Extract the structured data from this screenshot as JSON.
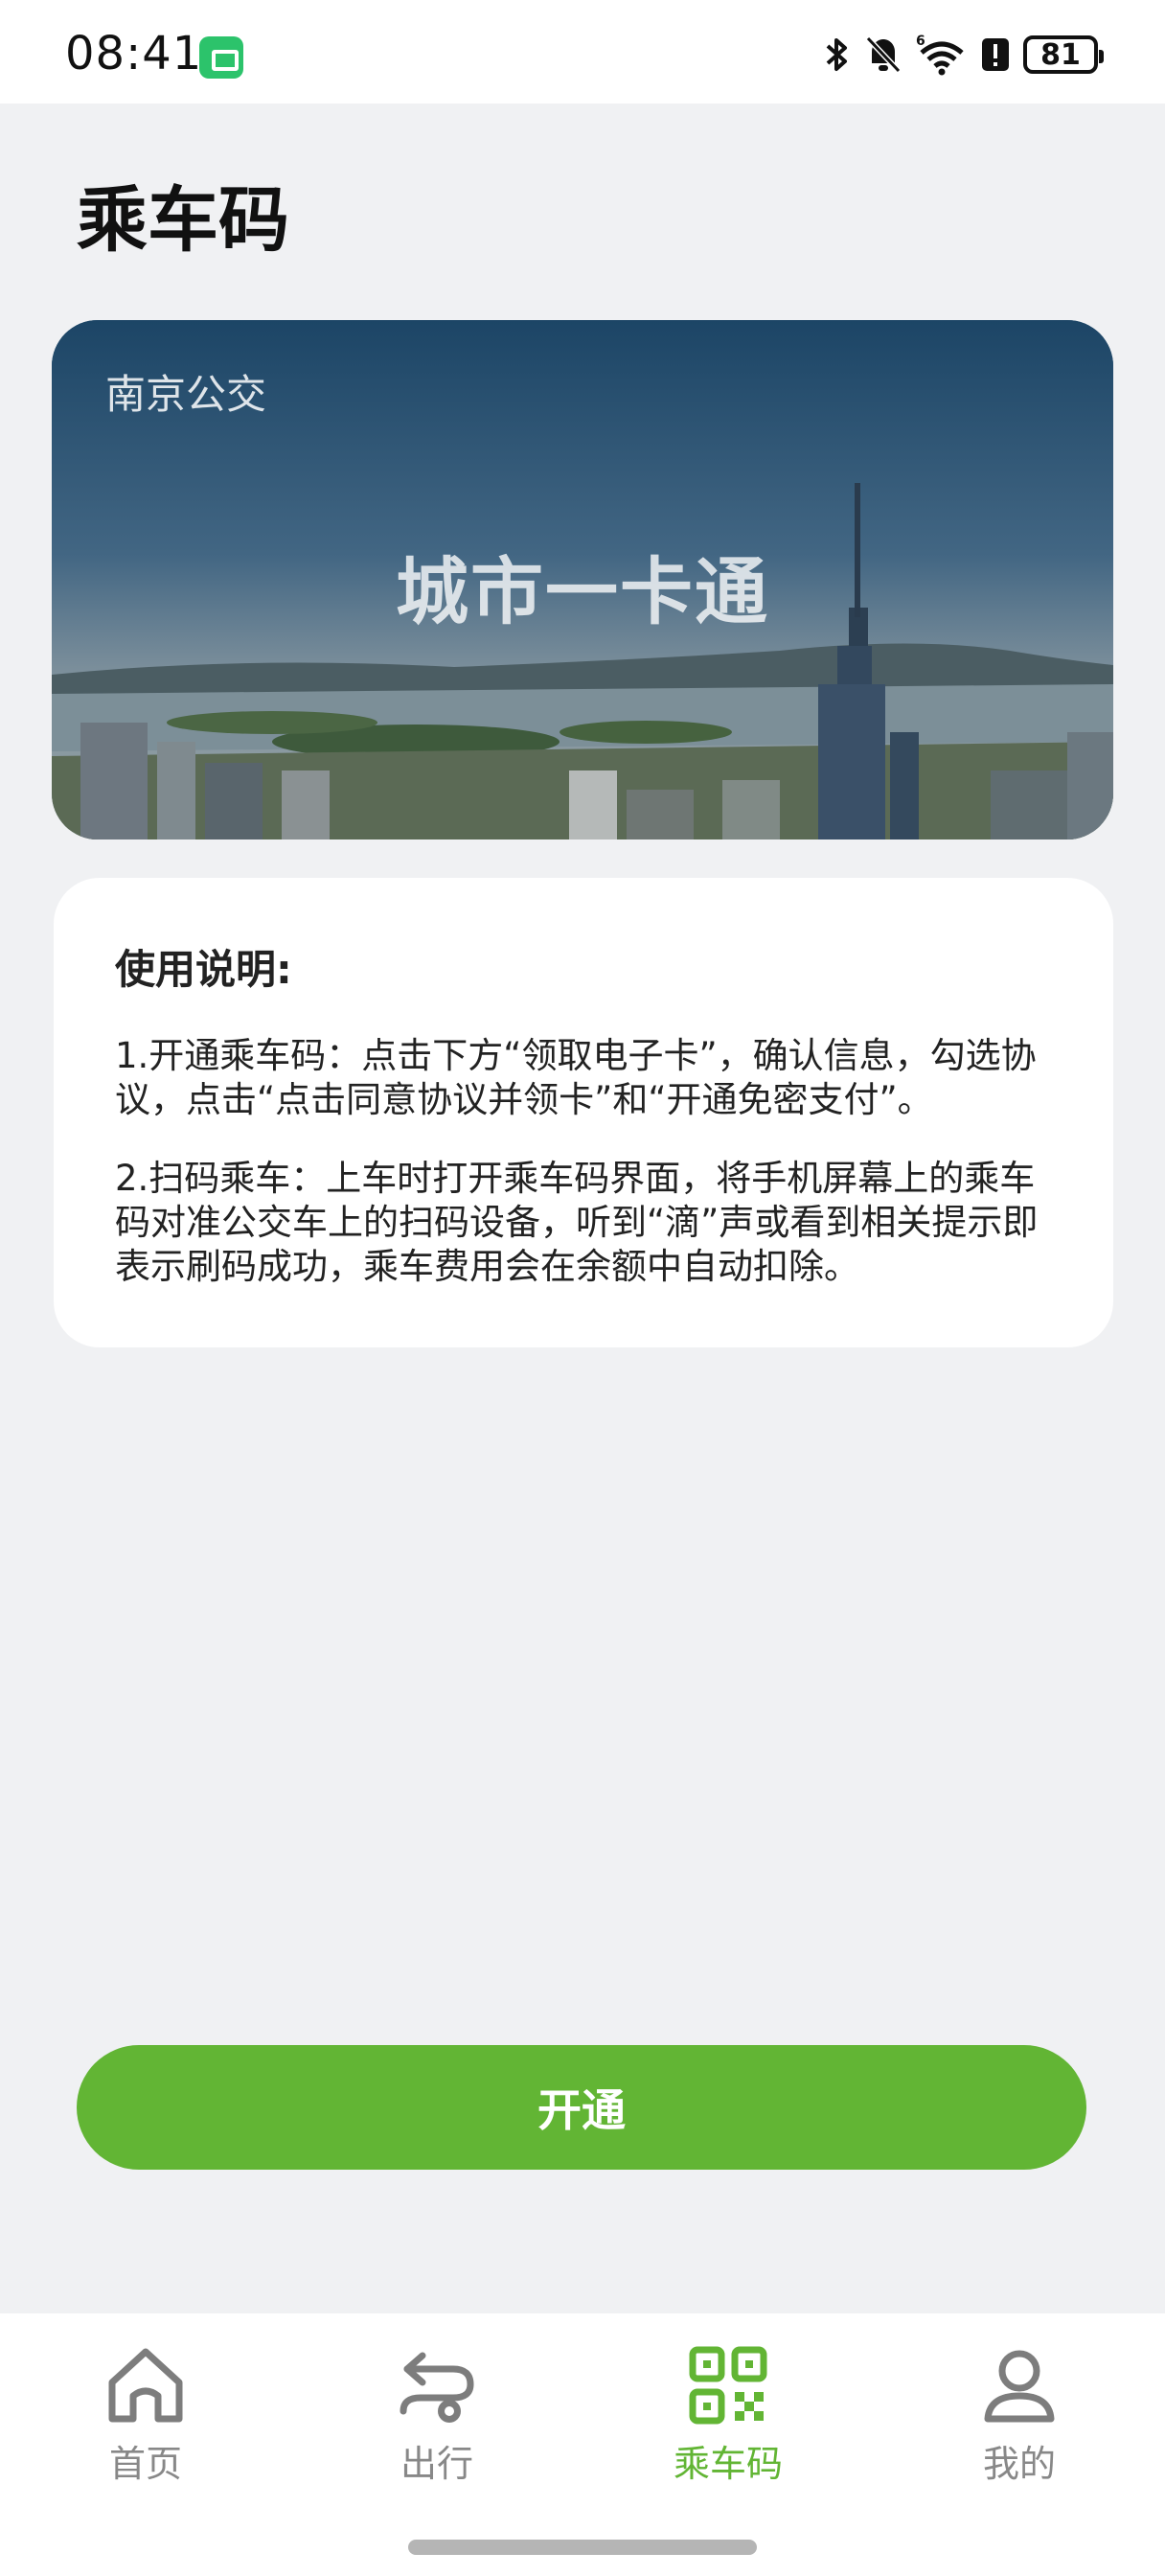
{
  "status_bar": {
    "time": "08:41",
    "battery": "81",
    "icons": [
      "app-notification-icon",
      "bluetooth-icon",
      "mute-bell-icon",
      "wifi-6-icon",
      "alert-icon",
      "battery-icon"
    ]
  },
  "page": {
    "title": "乘车码"
  },
  "card": {
    "brand": "南京公交",
    "title": "城市一卡通"
  },
  "instructions": {
    "heading": "使用说明:",
    "paragraphs": [
      "1.开通乘车码：点击下方“领取电子卡”，确认信息，勾选协议，点击“点击同意协议并领卡”和“开通免密支付”。",
      " 2.扫码乘车：上车时打开乘车码界面，将手机屏幕上的乘车码对准公交车上的扫码设备，听到“滴”声或看到相关提示即表示刷码成功，乘车费用会在余额中自动扣除。"
    ]
  },
  "action": {
    "open_label": "开通"
  },
  "nav": {
    "items": [
      {
        "label": "首页",
        "icon": "home-icon",
        "active": false
      },
      {
        "label": "出行",
        "icon": "travel-icon",
        "active": false
      },
      {
        "label": "乘车码",
        "icon": "qr-code-icon",
        "active": true
      },
      {
        "label": "我的",
        "icon": "profile-icon",
        "active": false
      }
    ]
  },
  "colors": {
    "accent": "#62b534",
    "background": "#f0f1f3"
  }
}
